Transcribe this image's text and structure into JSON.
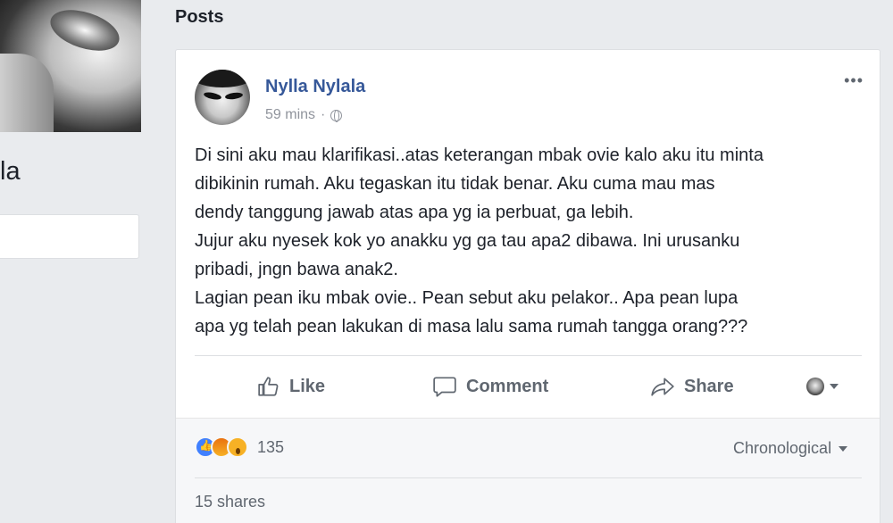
{
  "profile": {
    "name_fragment": "la"
  },
  "posts_section": {
    "heading": "Posts"
  },
  "post": {
    "author": "Nylla Nylala",
    "time": "59 mins",
    "separator": "·",
    "privacy_icon": "globe-icon",
    "more_icon": "•••",
    "text_lines": [
      "Di sini aku mau klarifikasi..atas keterangan mbak ovie kalo aku itu minta",
      "dibikinin rumah. Aku tegaskan itu tidak benar. Aku cuma mau mas",
      "dendy tanggung jawab atas apa yg ia perbuat, ga lebih.",
      "Jujur aku nyesek kok yo anakku yg ga tau apa2 dibawa. Ini urusanku",
      "pribadi, jngn bawa anak2.",
      "Lagian pean iku mbak ovie.. Pean sebut aku pelakor.. Apa pean lupa",
      "apa yg telah pean lakukan di masa lalu sama rumah tangga orang???"
    ],
    "actions": {
      "like": "Like",
      "comment": "Comment",
      "share": "Share"
    },
    "reactions": {
      "types": [
        "like",
        "angry",
        "wow"
      ],
      "count": "135"
    },
    "sort": {
      "selected": "Chronological"
    },
    "shares": "15 shares"
  },
  "colors": {
    "link": "#365899",
    "muted": "#90949c",
    "text": "#1d2129",
    "background": "#e9ebee"
  }
}
